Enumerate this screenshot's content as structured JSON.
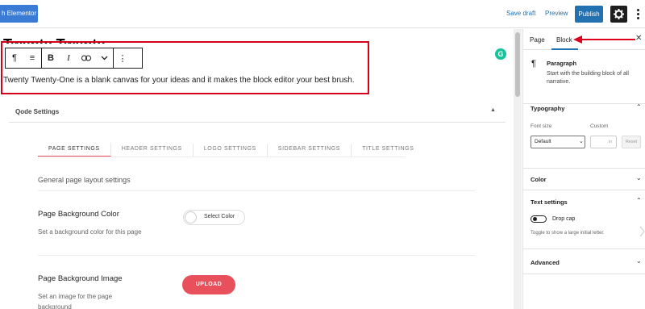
{
  "topbar": {
    "elementor_label": "h Elementor",
    "save_draft": "Save draft",
    "preview": "Preview",
    "publish": "Publish"
  },
  "editor": {
    "title_fragment": "Twenty Twenty",
    "paragraph": "Twenty Twenty-One is a blank canvas for your ideas and it makes the block editor your best brush.",
    "toolbar": {
      "paragraph_icon": "¶",
      "align_icon": "≡",
      "bold": "B",
      "italic": "I",
      "link_icon": "⊖",
      "more_rich_icon": "⌄",
      "options_icon": "⋮"
    },
    "grammarly": "G"
  },
  "qode": {
    "title": "Qode Settings",
    "tabs": [
      "PAGE SETTINGS",
      "HEADER SETTINGS",
      "LOGO SETTINGS",
      "SIDEBAR SETTINGS",
      "TITLE SETTINGS"
    ],
    "active_tab": 0,
    "section_heading": "General page layout settings",
    "bg_color": {
      "label": "Page Background Color",
      "desc": "Set a background color for this page",
      "button": "Select Color"
    },
    "bg_image": {
      "label": "Page Background Image",
      "desc_line1": "Set an image for the page",
      "desc_line2": "background",
      "button": "UPLOAD"
    },
    "accent_color": "#e8505b"
  },
  "sidebar": {
    "tab_page": "Page",
    "tab_block": "Block",
    "close": "✕",
    "block_name": "Paragraph",
    "block_desc": "Start with the building block of all narrative.",
    "typography": {
      "title": "Typography",
      "font_size_label": "Font size",
      "custom_label": "Custom",
      "select_value": "Default",
      "unit": "in",
      "reset": "Reset"
    },
    "color_title": "Color",
    "text_settings": {
      "title": "Text settings",
      "drop_cap": "Drop cap",
      "help": "Toggle to show a large initial letter."
    },
    "advanced_title": "Advanced"
  }
}
